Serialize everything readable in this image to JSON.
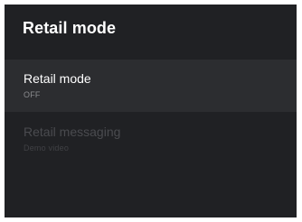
{
  "panel": {
    "title": "Retail mode"
  },
  "items": [
    {
      "label": "Retail mode",
      "value": "OFF",
      "state": "focused"
    },
    {
      "label": "Retail messaging",
      "value": "Demo video",
      "state": "disabled"
    }
  ],
  "colors": {
    "background": "#202124",
    "focused_row": "#2c2d30",
    "text_primary": "#ffffff",
    "text_secondary": "#8a8b8e",
    "text_disabled": "#4a4b4f"
  }
}
